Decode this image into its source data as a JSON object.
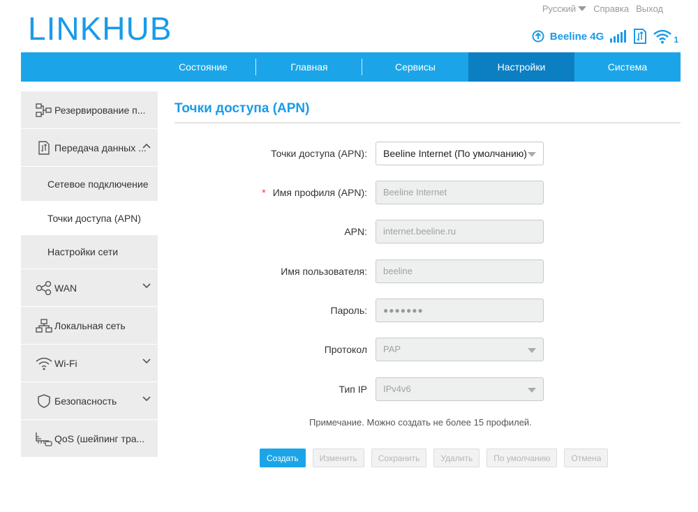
{
  "header": {
    "logo_part1": "LINK",
    "logo_part2": "HUB",
    "language": "Русский",
    "help": "Справка",
    "logout": "Выход",
    "operator": "Beeline 4G",
    "wifi_clients": "1"
  },
  "nav": {
    "items": [
      {
        "label": "Состояние"
      },
      {
        "label": "Главная"
      },
      {
        "label": "Сервисы"
      },
      {
        "label": "Настройки",
        "active": true
      },
      {
        "label": "Система"
      }
    ]
  },
  "sidebar": {
    "backup": "Резервирование п...",
    "data": "Передача данных ...",
    "data_sub": [
      "Сетевое подключение",
      "Точки доступа (APN)",
      "Настройки сети"
    ],
    "wan": "WAN",
    "lan": "Локальная сеть",
    "wifi": "Wi-Fi",
    "security": "Безопасность",
    "qos": "QoS (шейпинг тра..."
  },
  "main": {
    "title": "Точки доступа (APN)",
    "form": {
      "apn_select_label": "Точки доступа (APN):",
      "apn_select_value": "Beeline Internet (По умолчанию)",
      "profile_label": "Имя профиля (APN):",
      "profile_required": "*",
      "profile_value": "Beeline Internet",
      "apn_label": "APN:",
      "apn_value": "internet.beeline.ru",
      "user_label": "Имя пользователя:",
      "user_value": "beeline",
      "password_label": "Пароль:",
      "password_value": "●●●●●●●",
      "protocol_label": "Протокол",
      "protocol_value": "PAP",
      "iptype_label": "Тип IP",
      "iptype_value": "IPv4v6"
    },
    "note": "Примечание. Можно создать не более 15 профилей.",
    "buttons": {
      "create": "Создать",
      "edit": "Изменить",
      "save": "Сохранить",
      "delete": "Удалить",
      "default": "По умолчанию",
      "cancel": "Отмена"
    }
  },
  "colors": {
    "accent": "#1ba5e8",
    "nav_active": "#0c7fc3",
    "sidebar_bg": "#ececec"
  }
}
